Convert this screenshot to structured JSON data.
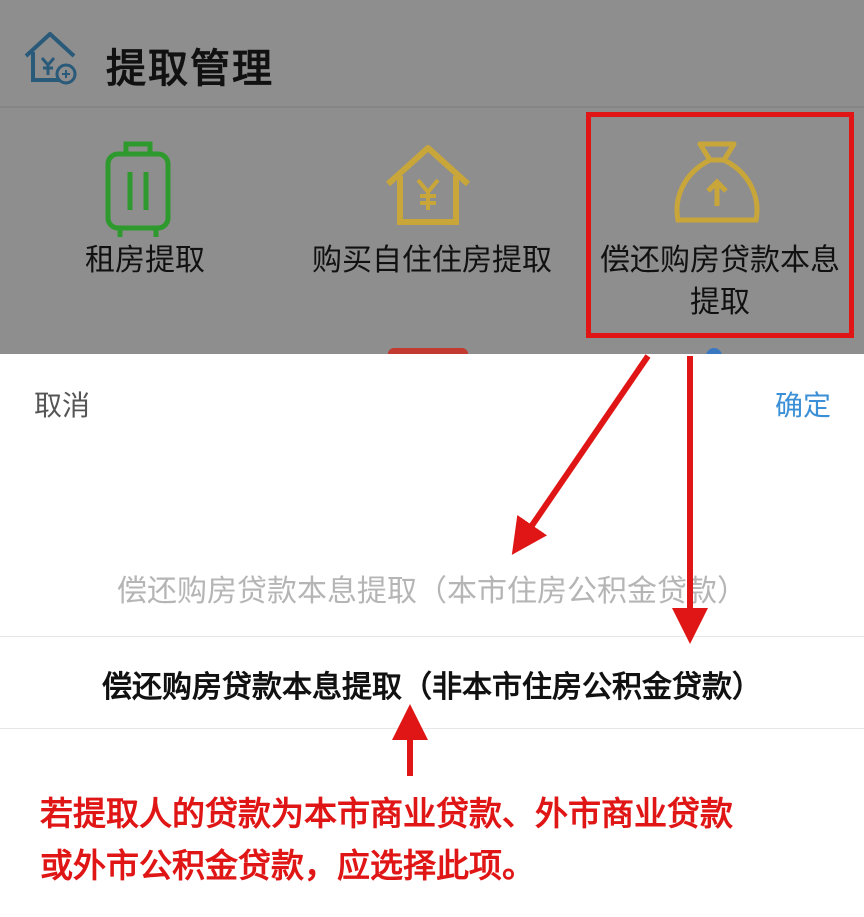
{
  "header": {
    "title": "提取管理",
    "logo_icon": "house-yen-icon"
  },
  "options": [
    {
      "label": "租房提取",
      "icon": "luggage-icon",
      "color": "#2e9a2e"
    },
    {
      "label": "购买自住住房提取",
      "icon": "house-yen-icon",
      "color": "#c9a63a"
    },
    {
      "label_line1": "偿还购房贷款本息",
      "label_line2": "提取",
      "icon": "money-bag-arrow-icon",
      "color": "#c9a63a"
    }
  ],
  "sheet": {
    "cancel": "取消",
    "confirm": "确定",
    "option_faded": "偿还购房贷款本息提取（本市住房公积金贷款）",
    "option_selected": "偿还购房贷款本息提取（非本市住房公积金贷款）"
  },
  "annotation": {
    "line1": "若提取人的贷款为本市商业贷款、外市商业贷款",
    "line2": "或外市公积金贷款，应选择此项。"
  },
  "colors": {
    "annotation_red": "#e01616",
    "confirm_blue": "#3a8fd6",
    "overlay_gray": "#8e8e8e"
  }
}
